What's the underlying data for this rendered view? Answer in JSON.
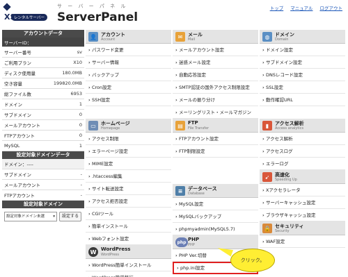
{
  "header": {
    "brand": "XSERVER",
    "rental": "レンタルサーバー",
    "panel_ja": "サ ー バ ー パ ネ ル",
    "panel_en": "ServerPanel",
    "links": [
      "トップ",
      "マニュアル",
      "ログアウト"
    ]
  },
  "sidebar": {
    "account_head": "アカウントデータ",
    "server_id_label": "サーバーID：",
    "rows": [
      {
        "k": "サーバー番号",
        "v": "sv"
      },
      {
        "k": "ご利用プラン",
        "v": "X10"
      },
      {
        "k": "ディスク使用量",
        "v": "180.0MB"
      },
      {
        "k": "空き容量",
        "v": "199820.0MB"
      },
      {
        "k": "総ファイル数",
        "v": "6953"
      },
      {
        "k": "ドメイン",
        "v": "1"
      },
      {
        "k": "サブドメイン",
        "v": "0"
      },
      {
        "k": "メールアカウント",
        "v": "0"
      },
      {
        "k": "FTPアカウント",
        "v": "0"
      },
      {
        "k": "MySQL",
        "v": "1"
      }
    ],
    "domain_head": "設定対象ドメインデータ",
    "domain_label": "ドメイン：----",
    "domain_rows": [
      {
        "k": "サブドメイン",
        "v": "-"
      },
      {
        "k": "メールアカウント",
        "v": "-"
      },
      {
        "k": "FTPアカウント",
        "v": "-"
      }
    ],
    "select_head": "設定対象ドメイン",
    "select_value": "設定対象ドメイン未選",
    "select_button": "設定する"
  },
  "columns": {
    "account": {
      "title": "アカウント",
      "sub": "Account",
      "color": "#5a8fc4",
      "items": [
        "パスワード変更",
        "サーバー情報",
        "バックアップ",
        "Cron設定",
        "SSH設定"
      ]
    },
    "home": {
      "title": "ホームページ",
      "sub": "Homepage",
      "color": "#6e8db5",
      "items": [
        "アクセス制限",
        "エラーページ設定",
        "MIME設定",
        ".htaccess編集",
        "サイト転送設定",
        "アクセス拒否設定",
        "CGIツール",
        "簡単インストール",
        "Webフォント設定"
      ]
    },
    "wp": {
      "title": "WordPress",
      "sub": "WordPress",
      "color": "#3a3a3a",
      "items": [
        "WordPress簡単インストール",
        "WordPress簡単移行"
      ]
    },
    "mail": {
      "title": "メール",
      "sub": "Mail",
      "color": "#e8a23a",
      "items": [
        "メールアカウント設定",
        "迷惑メール設定",
        "自動応答設定",
        "SMTP認証の国外アクセス制限設定",
        "メールの振り分け",
        "メーリングリスト・メールマガジン"
      ]
    },
    "ftp": {
      "title": "FTP",
      "sub": "File Transfer",
      "color": "#e8a23a",
      "items": [
        "FTPアカウント設定",
        "FTP制限設定"
      ]
    },
    "db": {
      "title": "データベース",
      "sub": "Database",
      "color": "#4f7fa8",
      "items": [
        "MySQL設定",
        "MySQLバックアップ",
        "phpmyadmin(MySQL5.7)"
      ]
    },
    "php": {
      "title": "PHP",
      "sub": "PHP",
      "color": "#6b7fb5",
      "items": [
        "PHP Ver.切替",
        "php.ini設定"
      ]
    },
    "domain": {
      "title": "ドメイン",
      "sub": "Domain",
      "color": "#5a8fc4",
      "items": [
        "ドメイン設定",
        "サブドメイン設定",
        "DNSレコード設定",
        "SSL設定",
        "動作確認URL"
      ]
    },
    "access": {
      "title": "アクセス解析",
      "sub": "Access analytics",
      "color": "#d9573a",
      "items": [
        "アクセス解析",
        "アクセスログ",
        "エラーログ"
      ]
    },
    "speed": {
      "title": "高速化",
      "sub": "Speeding Up",
      "color": "#d9573a",
      "items": [
        "Xアクセラレータ",
        "サーバーキャッシュ設定",
        "ブラウザキャッシュ設定"
      ]
    },
    "security": {
      "title": "セキュリティ",
      "sub": "Security",
      "color": "#d98a3a",
      "items": [
        "WAF設定"
      ]
    }
  },
  "callout": "クリック。"
}
